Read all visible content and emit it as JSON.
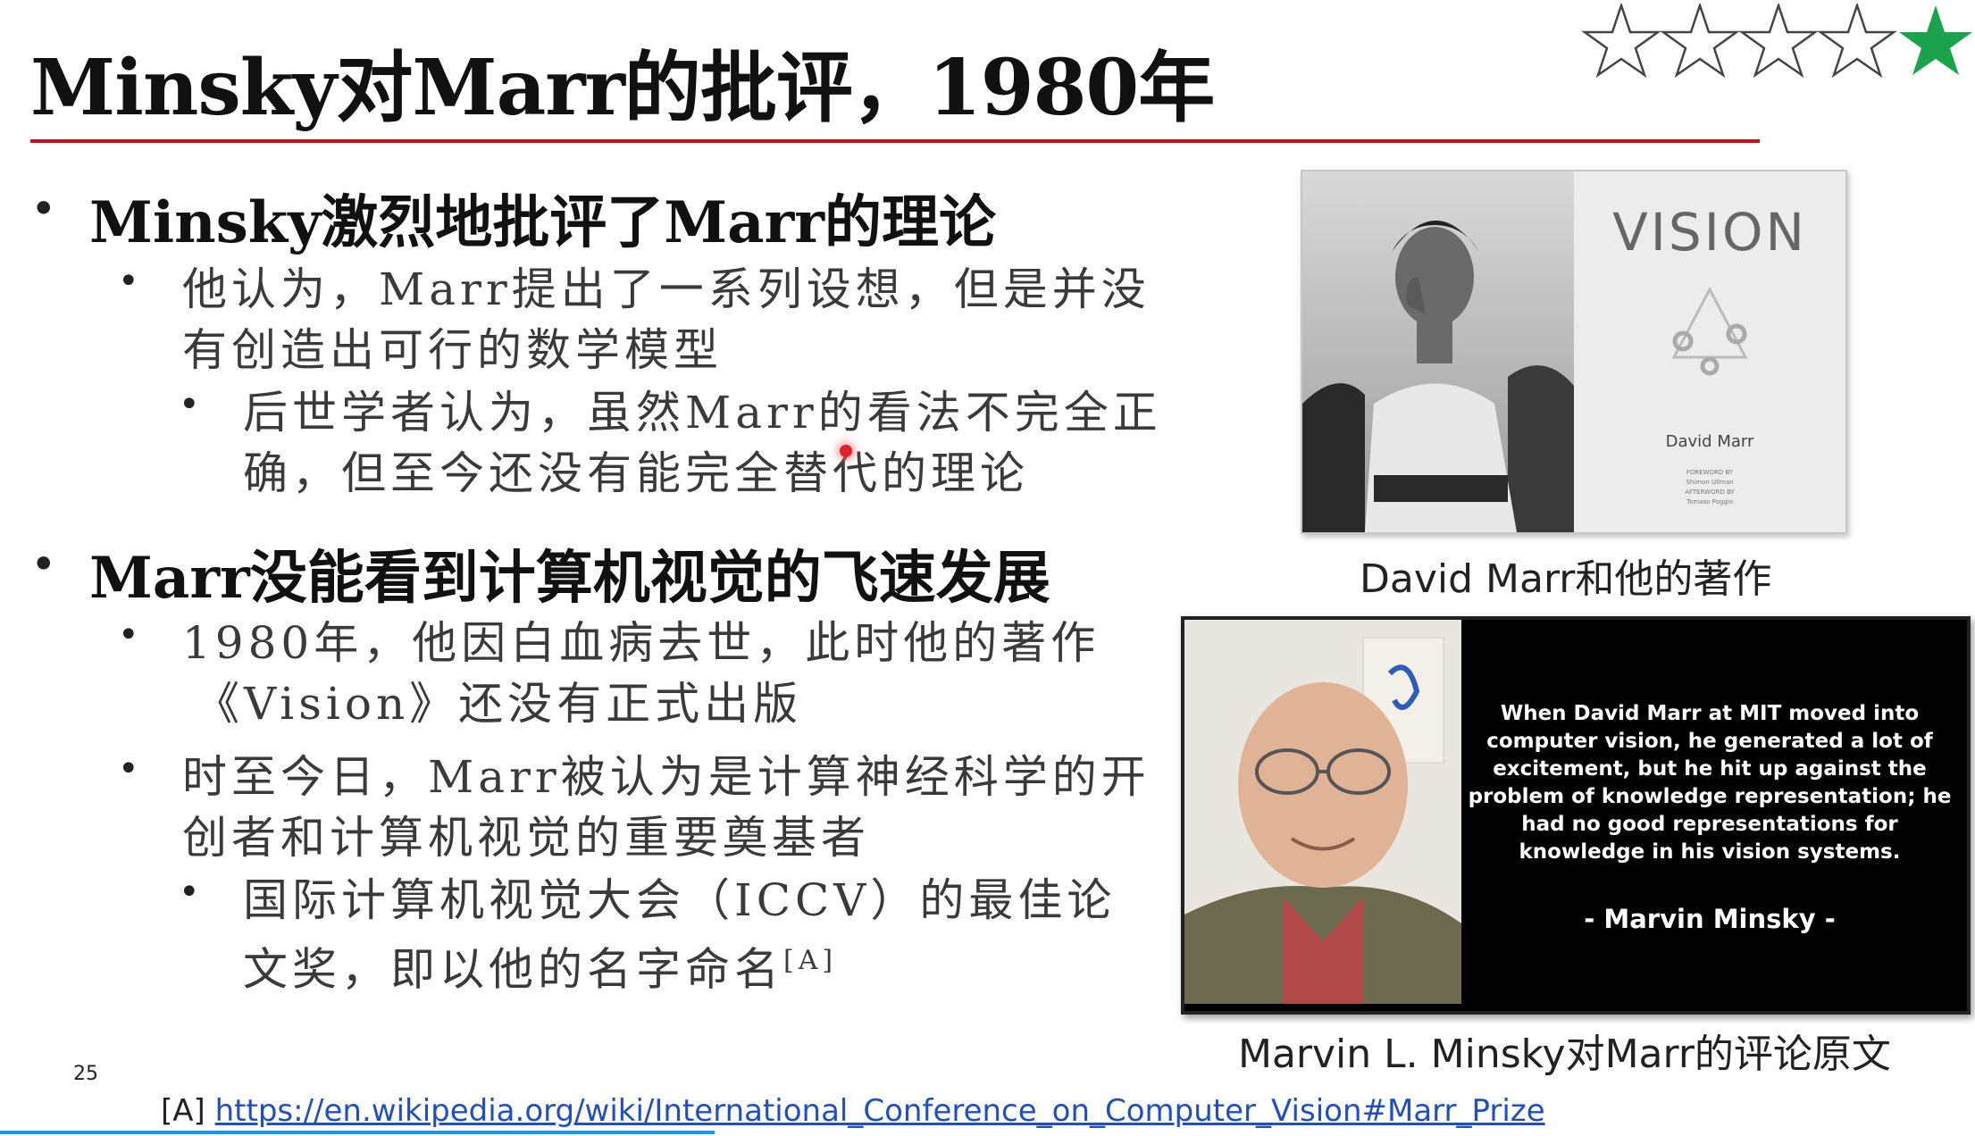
{
  "slide": {
    "title": "Minsky对Marr的批评，1980年",
    "page_number": "25",
    "rating": {
      "value": 1,
      "max": 5
    }
  },
  "section1": {
    "heading": "Minsky激烈地批评了Marr的理论",
    "sub1_line1": "他认为，Marr提出了一系列设想，但是并没",
    "sub1_line2": "有创造出可行的数学模型",
    "sub2_line1": "后世学者认为，虽然Marr的看法不完全正",
    "sub2_line2": "确，但至今还没有能完全替代的理论"
  },
  "section2": {
    "heading": "Marr没能看到计算机视觉的飞速发展",
    "sub1_line1": "1980年，他因白血病去世，此时他的著作",
    "sub1_line2": "《Vision》还没有正式出版",
    "sub2_line1": "时至今日，Marr被认为是计算神经科学的开",
    "sub2_line2": "创者和计算机视觉的重要奠基者",
    "sub3_line1": "国际计算机视觉大会（ICCV）的最佳论",
    "sub3_line2": "文奖，即以他的名字命名",
    "sub3_ref": "[A]"
  },
  "figure1": {
    "book_title": "VISION",
    "book_author": "David Marr",
    "book_small1": "FOREWORD BY",
    "book_small2": "Shimon Ullman",
    "book_small3": "AFTERWORD BY",
    "book_small4": "Tomaso Poggio",
    "caption": "David Marr和他的著作"
  },
  "figure2": {
    "quote": "When David Marr at MIT moved into computer vision, he generated a lot of excitement, but he hit up against the problem of knowledge representation; he had no good representations for knowledge in his vision systems.",
    "author": "- Marvin Minsky -",
    "caption": "Marvin L. Minsky对Marr的评论原文"
  },
  "footnote": {
    "marker": "[A]",
    "url": "https://en.wikipedia.org/wiki/International_Conference_on_Computer_Vision#Marr_Prize"
  },
  "colors": {
    "title_rule": "#c0141c",
    "star_filled": "#1aa34a",
    "link": "#1f4fc2"
  }
}
